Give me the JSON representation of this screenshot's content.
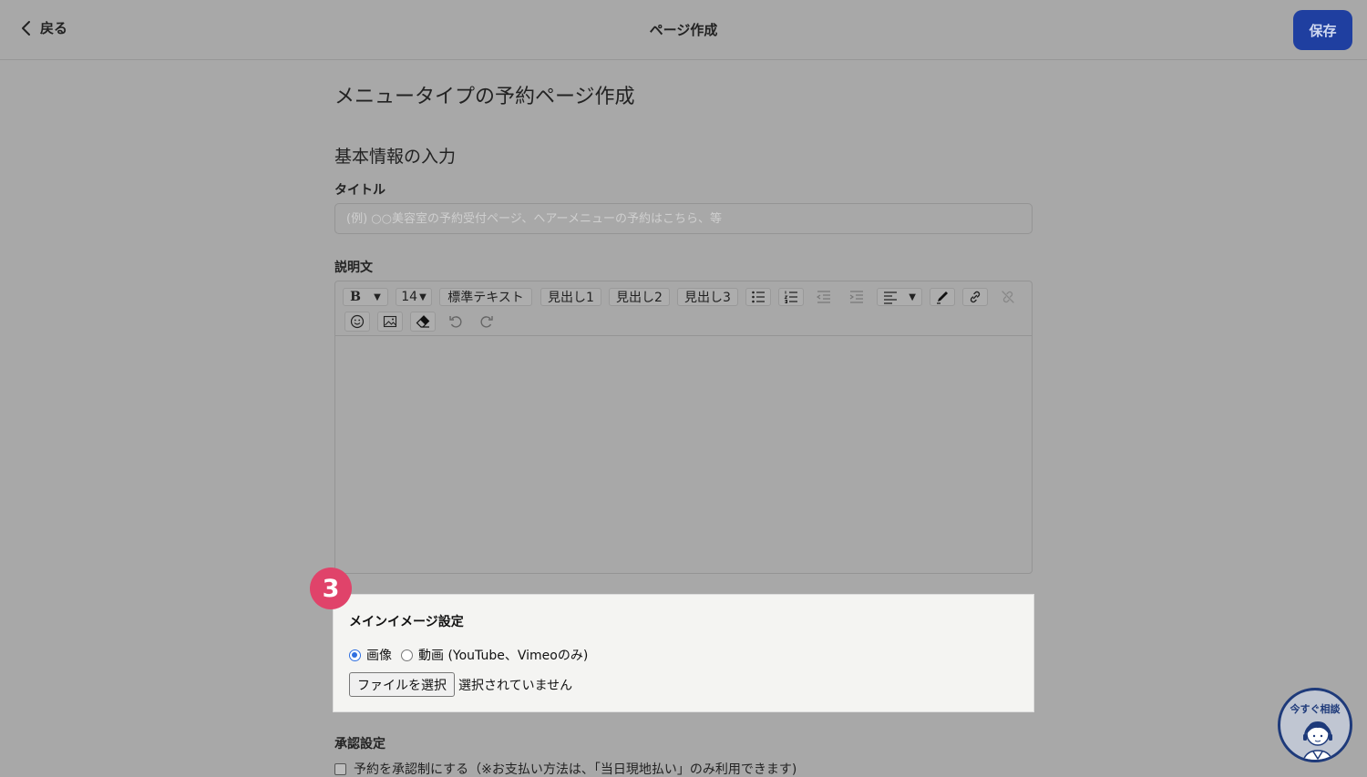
{
  "header": {
    "back_label": "戻る",
    "title": "ページ作成",
    "save_label": "保存",
    "save_color": "#1f3fa0"
  },
  "page": {
    "heading": "メニュータイプの予約ページ作成",
    "section": "基本情報の入力"
  },
  "title_field": {
    "label": "タイトル",
    "placeholder": "(例) ○○美容室の予約受付ページ、ヘアーメニューの予約はこちら、等",
    "value": ""
  },
  "description": {
    "label": "説明文",
    "toolbar": {
      "bold": "B",
      "font_size": "14",
      "normal_text": "標準テキスト",
      "h1": "見出し1",
      "h2": "見出し2",
      "h3": "見出し3"
    }
  },
  "main_image": {
    "step_number": "3",
    "step_color": "#e0436a",
    "title": "メインイメージ設定",
    "options": [
      {
        "label": "画像",
        "selected": true
      },
      {
        "label": "動画 (YouTube、Vimeoのみ)",
        "selected": false
      }
    ],
    "file_button": "ファイルを選択",
    "file_status": "選択されていません"
  },
  "approval": {
    "label": "承認設定",
    "checkbox_label": "予約を承認制にする（※お支払い方法は、「当日現地払い」のみ利用できます)",
    "checked": false
  },
  "chat": {
    "label": "今すぐ相談"
  }
}
